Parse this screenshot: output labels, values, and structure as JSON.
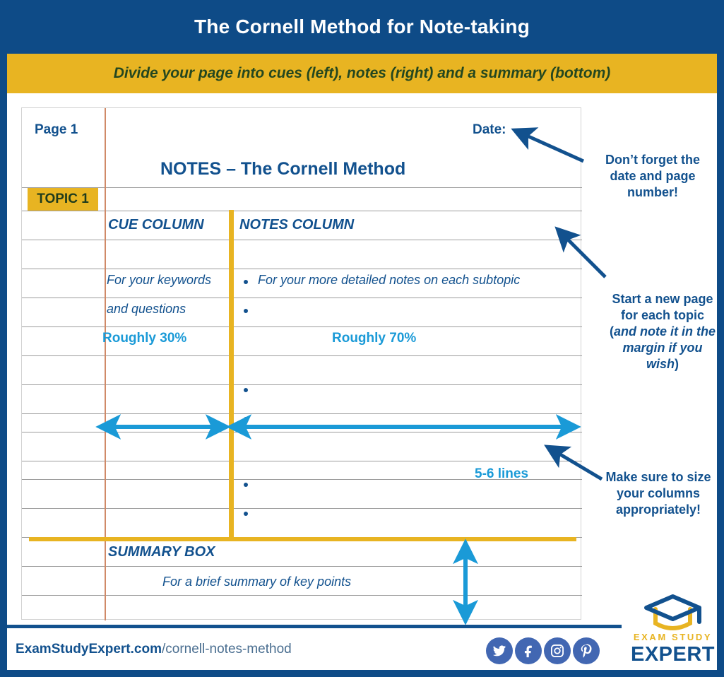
{
  "header": {
    "title": "The Cornell Method for Note-taking",
    "subtitle": "Divide your page into cues (left), notes (right) and a summary (bottom)"
  },
  "notebook": {
    "page_label": "Page 1",
    "date_label": "Date:",
    "notes_title": "NOTES – The Cornell Method",
    "topic_badge": "TOPIC 1",
    "cue_column_heading": "CUE COLUMN",
    "notes_column_heading": "NOTES COLUMN",
    "cue_text_line_1": "For your keywords",
    "cue_text_line_2": "and questions",
    "notes_bullet_1": "For your more detailed notes on each subtopic",
    "summary_heading": "SUMMARY BOX",
    "summary_text": "For a brief summary of key points"
  },
  "measurements": {
    "cue_width": "Roughly 30%",
    "notes_width": "Roughly 70%",
    "summary_height": "5-6 lines"
  },
  "annotations": [
    {
      "id": "date-page-note",
      "text": "Don’t forget the date and page number!"
    },
    {
      "id": "new-page-note",
      "text_plain": "Start a new page for each topic (",
      "text_italic": "and note it in the margin if you wish",
      "text_tail": ")"
    },
    {
      "id": "column-size-note",
      "text": "Make sure to size your columns appropriately!"
    }
  ],
  "footer": {
    "url_bold": "ExamStudyExpert.com",
    "url_light": "/cornell-notes-method",
    "social": [
      {
        "name": "twitter-icon",
        "glyph": "twitter"
      },
      {
        "name": "facebook-icon",
        "glyph": "facebook"
      },
      {
        "name": "instagram-icon",
        "glyph": "instagram"
      },
      {
        "name": "pinterest-icon",
        "glyph": "pinterest"
      }
    ],
    "logo_top": "EXAM STUDY",
    "logo_bottom": "EXPERT"
  },
  "colors": {
    "brand_blue": "#0e4b87",
    "brand_gold": "#e8b422",
    "text_blue": "#12518e",
    "accent_cyan": "#1a9ad7",
    "margin_red": "#d08a68",
    "rule_gray": "#9c9c9c",
    "social_blue": "#4267b2"
  }
}
